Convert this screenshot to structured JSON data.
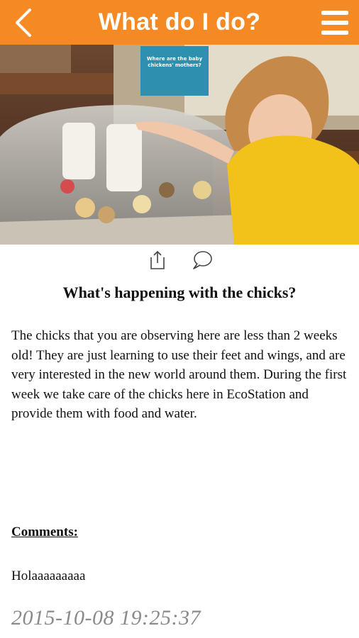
{
  "header": {
    "title": "What do I do?",
    "back_icon": "chevron-left-icon",
    "menu_icon": "hamburger-menu-icon"
  },
  "photo": {
    "sign_lines": [
      "Where are the baby",
      "chickens' mothers?"
    ]
  },
  "actions": {
    "share_icon": "share-icon",
    "comment_icon": "speech-bubble-icon"
  },
  "article": {
    "heading": "What's happening with the chicks?",
    "body": "The chicks that you are observing here are less than 2 weeks old! They are just learning to use their feet and wings, and are very interested in the new world around them. During the first week we take care of the chicks here in EcoStation and provide them with food and water."
  },
  "comments": {
    "label": "Comments:",
    "items": [
      {
        "text": "Holaaaaaaaaa",
        "date": "2015-10-08 19:25:37"
      }
    ]
  },
  "colors": {
    "header": "#f58a25",
    "date": "#8a8a8a"
  }
}
